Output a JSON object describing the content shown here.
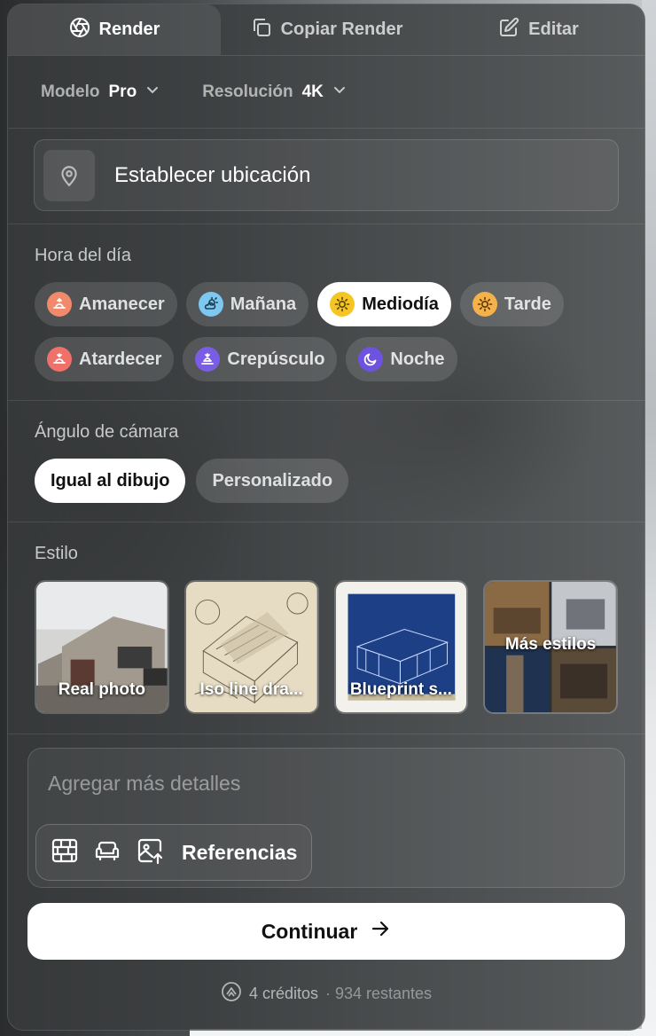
{
  "tabs": [
    {
      "label": "Render",
      "icon": "aperture-icon",
      "active": true
    },
    {
      "label": "Copiar Render",
      "icon": "copy-icon",
      "active": false
    },
    {
      "label": "Editar",
      "icon": "edit-icon",
      "active": false
    }
  ],
  "settings": {
    "model_label": "Modelo",
    "model_value": "Pro",
    "resolution_label": "Resolución",
    "resolution_value": "4K"
  },
  "location": {
    "label": "Establecer ubicación",
    "icon": "map-pin-icon"
  },
  "time_of_day": {
    "title": "Hora del día",
    "options": [
      {
        "label": "Amanecer",
        "icon": "sunrise-icon",
        "color": "#f08a6a",
        "active": false
      },
      {
        "label": "Mañana",
        "icon": "sun-cloud-icon",
        "color": "#7cc8f0",
        "active": false
      },
      {
        "label": "Mediodía",
        "icon": "sun-icon",
        "color": "#f5c523",
        "active": true
      },
      {
        "label": "Tarde",
        "icon": "sun-icon",
        "color": "#f6b24a",
        "active": false
      },
      {
        "label": "Atardecer",
        "icon": "sunset-icon",
        "color": "#f0706a",
        "active": false
      },
      {
        "label": "Crepúsculo",
        "icon": "dusk-icon",
        "color": "#7a5ce6",
        "active": false
      },
      {
        "label": "Noche",
        "icon": "moon-icon",
        "color": "#6e52e0",
        "active": false
      }
    ]
  },
  "camera": {
    "title": "Ángulo de cámara",
    "options": [
      {
        "label": "Igual al dibujo",
        "active": true
      },
      {
        "label": "Personalizado",
        "active": false
      }
    ]
  },
  "style": {
    "title": "Estilo",
    "cards": [
      {
        "label": "Real photo"
      },
      {
        "label": "Iso line dra..."
      },
      {
        "label": "Blueprint s..."
      },
      {
        "label": "Más estilos"
      }
    ]
  },
  "details": {
    "placeholder": "Agregar más detalles",
    "references_label": "Referencias"
  },
  "continue_label": "Continuar",
  "credits": {
    "cost": "4 créditos",
    "remaining": "· 934 restantes"
  }
}
